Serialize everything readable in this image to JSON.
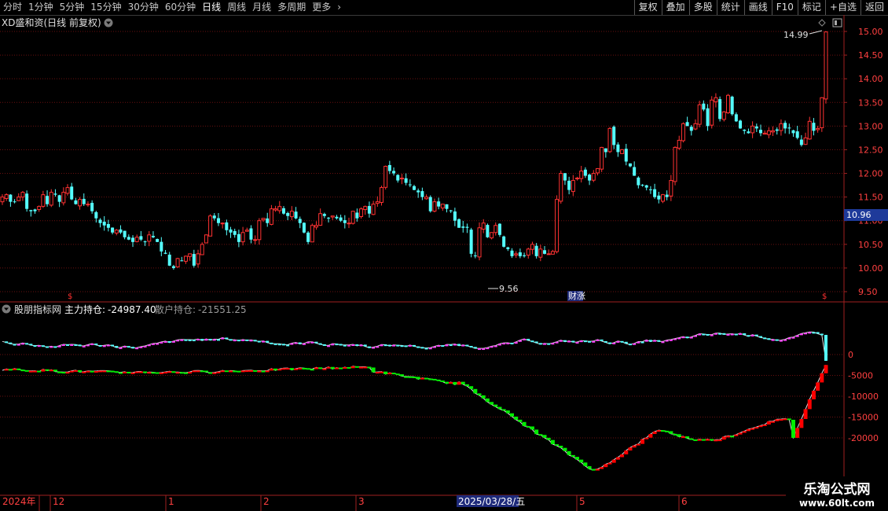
{
  "toolbar": {
    "periods": [
      "分时",
      "1分钟",
      "5分钟",
      "15分钟",
      "30分钟",
      "60分钟",
      "日线",
      "周线",
      "月线",
      "多周期",
      "更多"
    ],
    "active_period": "日线",
    "buttons": [
      "复权",
      "叠加",
      "多股",
      "统计",
      "画线",
      "F10",
      "标记",
      "+自选",
      "返回"
    ]
  },
  "main_panel": {
    "title": "XD盛和资(日线 前复权)",
    "y_ticks": [
      "15.00",
      "14.50",
      "14.00",
      "13.50",
      "13.00",
      "12.50",
      "12.00",
      "11.50",
      "11.00",
      "10.50",
      "10.00",
      "9.50"
    ],
    "current_price": "10.96",
    "high_label": "14.99",
    "low_label": "9.56",
    "marker_label": "财涨"
  },
  "indicator_panel": {
    "name": "股朋指标网",
    "line1_label": "主力持仓:",
    "line1_value": "-24987.40",
    "line2_label": "散户持仓:",
    "line2_value": "-21551.25",
    "y_ticks": [
      "0",
      "-5000",
      "-10000",
      "-15000",
      "-20000"
    ]
  },
  "date_axis": {
    "year_label": "2024年",
    "month_labels": [
      "12",
      "1",
      "2",
      "3",
      "5",
      "6"
    ],
    "cursor_date": "2025/03/28/五"
  },
  "watermark": {
    "line1": "乐淘公式网",
    "line2": "www.60lt.com"
  },
  "colors": {
    "up": "#ff3232",
    "down": "#54ffff",
    "grid": "#7a1414",
    "retail_line": "#ff40ff",
    "main_up": "#ff0000",
    "main_down": "#00ee00"
  },
  "chart_data": {
    "type": "candlestick",
    "price_series": {
      "name": "XD盛和资",
      "close": [
        11.5,
        11.55,
        11.4,
        11.4,
        11.5,
        11.6,
        11.25,
        11.2,
        11.2,
        11.3,
        11.55,
        11.35,
        11.6,
        11.55,
        11.4,
        11.6,
        11.7,
        11.45,
        11.35,
        11.45,
        11.35,
        11.35,
        11.2,
        11.05,
        10.95,
        10.9,
        10.85,
        10.75,
        10.8,
        10.75,
        10.65,
        10.6,
        10.55,
        10.65,
        10.6,
        10.55,
        10.7,
        10.65,
        10.55,
        10.35,
        10.3,
        10.05,
        10.0,
        10.2,
        10.15,
        10.25,
        10.3,
        10.05,
        10.3,
        10.5,
        10.7,
        11.1,
        11.05,
        10.95,
        10.95,
        10.8,
        10.75,
        10.7,
        10.55,
        10.75,
        10.8,
        10.6,
        10.6,
        11.0,
        11.05,
        10.95,
        11.25,
        11.25,
        11.3,
        11.15,
        11.1,
        11.2,
        11.05,
        10.95,
        10.75,
        10.55,
        10.9,
        10.9,
        11.15,
        11.1,
        11.05,
        11.1,
        11.05,
        11.0,
        10.95,
        10.95,
        11.2,
        11.05,
        11.25,
        11.3,
        11.15,
        11.35,
        11.4,
        11.7,
        12.15,
        12.05,
        12.0,
        11.85,
        11.9,
        11.8,
        11.75,
        11.65,
        11.6,
        11.5,
        11.5,
        11.2,
        11.4,
        11.3,
        11.35,
        11.25,
        11.2,
        11.0,
        10.85,
        10.85,
        10.85,
        10.3,
        10.25,
        10.85,
        10.95,
        10.65,
        10.75,
        10.9,
        10.7,
        10.45,
        10.4,
        10.25,
        10.3,
        10.25,
        10.25,
        10.4,
        10.5,
        10.25,
        10.4,
        10.3,
        10.3,
        10.35,
        11.45,
        12.0,
        11.85,
        11.65,
        11.85,
        11.9,
        12.05,
        11.95,
        11.85,
        12.0,
        12.1,
        12.55,
        12.45,
        12.95,
        12.6,
        12.45,
        12.5,
        12.25,
        12.15,
        11.95,
        11.75,
        11.75,
        11.7,
        11.65,
        11.5,
        11.45,
        11.55,
        11.5,
        11.85,
        12.55,
        12.7,
        13.05,
        13.0,
        12.9,
        13.05,
        13.45,
        13.35,
        13.0,
        13.55,
        13.6,
        13.15,
        13.3,
        13.65,
        13.25,
        13.1,
        12.95,
        12.9,
        12.85,
        13.0,
        12.95,
        12.85,
        12.85,
        12.9,
        12.9,
        12.9,
        13.05,
        12.95,
        12.95,
        12.85,
        12.75,
        12.6,
        12.75,
        13.1,
        12.9,
        12.95,
        13.6,
        14.99
      ],
      "price_range": [
        9.4,
        15.2
      ]
    },
    "indicator_series": [
      {
        "name": "主力持仓",
        "last": -24987.4
      },
      {
        "name": "散户持仓",
        "last": -21551.25
      }
    ],
    "indicator_range": [
      -29000,
      6500
    ]
  }
}
